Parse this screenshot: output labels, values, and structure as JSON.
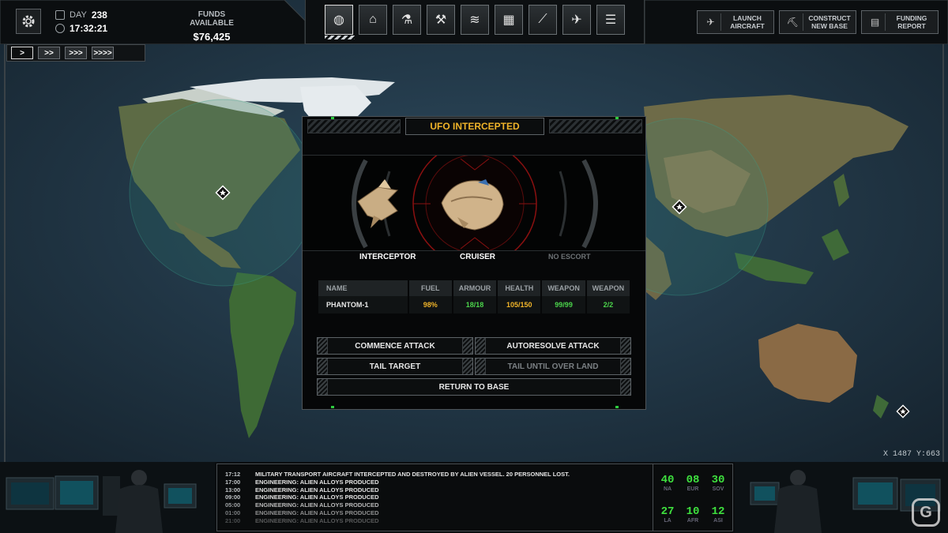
{
  "top": {
    "day_label": "DAY",
    "day_value": "238",
    "time": "17:32:21",
    "funds_label": "FUNDS AVAILABLE",
    "funds_value": "$76,425",
    "speed_buttons": [
      ">",
      ">>",
      ">>>",
      ">>>>"
    ],
    "nav_tabs": [
      "geoscape-globe",
      "base-hangar",
      "research-lab",
      "engineering-wrench",
      "soldiers-rank",
      "stores-crates",
      "weapons-rifle",
      "aircraft-jet",
      "reports-filing"
    ],
    "launch_aircraft": "LAUNCH AIRCRAFT",
    "construct_base": "CONSTRUCT NEW BASE",
    "funding_report": "FUNDING REPORT"
  },
  "map": {
    "cursor_readout": "X 1487  Y:663"
  },
  "modal": {
    "title": "UFO INTERCEPTED",
    "interceptor_label": "INTERCEPTOR",
    "target_label": "CRUISER",
    "escort_label": "NO ESCORT",
    "table": {
      "headers": [
        "NAME",
        "FUEL",
        "ARMOUR",
        "HEALTH",
        "WEAPON",
        "WEAPON"
      ],
      "rows": [
        {
          "name": "PHANTOM-1",
          "fuel": "98%",
          "armour": "18/18",
          "health": "105/150",
          "weapon1": "99/99",
          "weapon2": "2/2"
        }
      ]
    },
    "actions": {
      "commence": "COMMENCE ATTACK",
      "autoresolve": "AUTORESOLVE ATTACK",
      "tail": "TAIL TARGET",
      "tail_land": "TAIL UNTIL OVER LAND",
      "return": "RETURN TO BASE"
    }
  },
  "log": [
    {
      "time": "17:12",
      "msg": "MILITARY TRANSPORT AIRCRAFT INTERCEPTED AND DESTROYED BY ALIEN VESSEL. 20 PERSONNEL LOST."
    },
    {
      "time": "17:00",
      "msg": "ENGINEERING: ALIEN ALLOYS PRODUCED"
    },
    {
      "time": "13:00",
      "msg": "ENGINEERING: ALIEN ALLOYS PRODUCED"
    },
    {
      "time": "09:00",
      "msg": "ENGINEERING: ALIEN ALLOYS PRODUCED"
    },
    {
      "time": "05:00",
      "msg": "ENGINEERING: ALIEN ALLOYS PRODUCED"
    },
    {
      "time": "01:00",
      "msg": "ENGINEERING: ALIEN ALLOYS PRODUCED"
    },
    {
      "time": "21:00",
      "msg": "ENGINEERING: ALIEN ALLOYS PRODUCED"
    }
  ],
  "regions": [
    {
      "value": "40",
      "code": "NA"
    },
    {
      "value": "08",
      "code": "EUR"
    },
    {
      "value": "30",
      "code": "SOV"
    },
    {
      "value": "27",
      "code": "LA"
    },
    {
      "value": "10",
      "code": "AFR"
    },
    {
      "value": "12",
      "code": "ASI"
    }
  ],
  "watermark": "G",
  "colors": {
    "accent_yellow": "#f0b429",
    "stat_green": "#4bd44b",
    "region_green": "#3ee03e",
    "ocean": "#223a4c"
  }
}
